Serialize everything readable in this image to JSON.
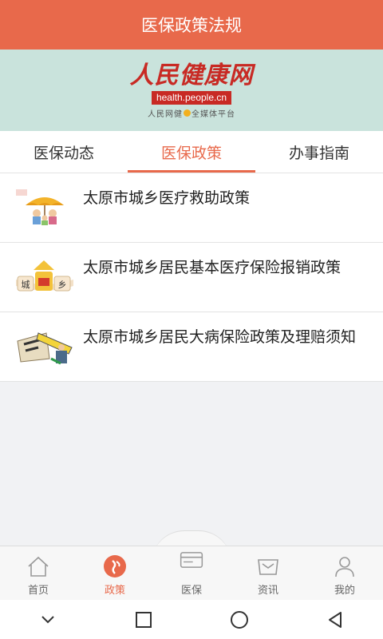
{
  "header": {
    "title": "医保政策法规"
  },
  "banner": {
    "logo_text": "人民健康网",
    "url_text": "health.people.cn",
    "sub_left": "人民网健",
    "sub_right": "全媒体平台"
  },
  "tabs": [
    {
      "label": "医保动态",
      "active": false
    },
    {
      "label": "医保政策",
      "active": true
    },
    {
      "label": "办事指南",
      "active": false
    }
  ],
  "articles": [
    {
      "title": "太原市城乡医疗救助政策",
      "thumb": "umbrella-family-thumbnail"
    },
    {
      "title": "太原市城乡居民基本医疗保险报销政策",
      "thumb": "city-rural-thumbnail"
    },
    {
      "title": "太原市城乡居民大病保险政策及理赔须知",
      "thumb": "illness-insurance-thumbnail"
    }
  ],
  "tabbar": [
    {
      "label": "首页",
      "icon": "home-icon",
      "active": false
    },
    {
      "label": "政策",
      "icon": "policy-icon",
      "active": true
    },
    {
      "label": "医保",
      "icon": "card-icon",
      "active": false
    },
    {
      "label": "资讯",
      "icon": "news-icon",
      "active": false
    },
    {
      "label": "我的",
      "icon": "profile-icon",
      "active": false
    }
  ],
  "colors": {
    "accent": "#e8694b",
    "banner_bg": "#c9e3dc",
    "logo_red": "#c82a24"
  }
}
